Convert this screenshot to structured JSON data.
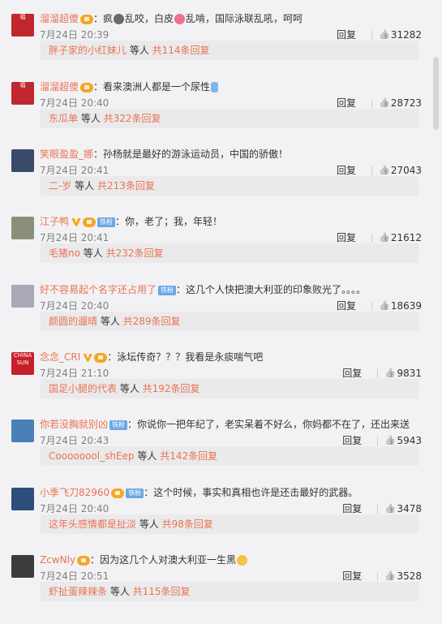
{
  "comments": [
    {
      "user": "溜溜超傻",
      "badges": [
        "crown"
      ],
      "text_parts": [
        "：疯",
        "乱咬，白皮",
        "乱啃，国际泳联乱吼，呵呵"
      ],
      "emojis": [
        "ghost-emoji",
        "pig-emoji"
      ],
      "time": "7月24日 20:39",
      "reply_label": "回复",
      "likes": "31282",
      "sub_user": "胖子家的小红妹儿",
      "sub_mid": " 等人 ",
      "sub_total": "共114条回复",
      "avatar_text": "福",
      "avatar_color": "#c0282d"
    },
    {
      "user": "溜溜超傻",
      "badges": [
        "crown"
      ],
      "text_parts": [
        "：看来澳洲人都是一个尿性",
        "",
        ""
      ],
      "emojis": [
        "drink-emoji"
      ],
      "time": "7月24日 20:40",
      "reply_label": "回复",
      "likes": "28723",
      "sub_user": "东瓜单",
      "sub_mid": " 等人 ",
      "sub_total": "共322条回复",
      "avatar_text": "福",
      "avatar_color": "#c0282d"
    },
    {
      "user": "笑眼盈盈_娜",
      "badges": [],
      "text_parts": [
        "：孙杨就是最好的游泳运动员，中国的骄傲！",
        "",
        ""
      ],
      "emojis": [],
      "time": "7月24日 20:41",
      "reply_label": "回复",
      "likes": "27043",
      "sub_user": "二-岁",
      "sub_mid": " 等人 ",
      "sub_total": "共213条回复",
      "avatar_text": "",
      "avatar_color": "#3a4a6b"
    },
    {
      "user": "江子鸭",
      "badges": [
        "vip",
        "crown",
        "tiefen"
      ],
      "text_parts": [
        "：你，老了；我，年轻！",
        "",
        ""
      ],
      "emojis": [],
      "time": "7月24日 20:41",
      "reply_label": "回复",
      "likes": "21612",
      "sub_user": "毛猪no",
      "sub_mid": " 等人 ",
      "sub_total": "共232条回复",
      "avatar_text": "",
      "avatar_color": "#8a8f7a"
    },
    {
      "user": "好不容易起个名字还占用了",
      "badges": [
        "tiefen"
      ],
      "text_parts": [
        "：这几个人快把澳大利亚的印象败光了。。。。",
        "",
        ""
      ],
      "emojis": [],
      "time": "7月24日 20:40",
      "reply_label": "回复",
      "likes": "18639",
      "sub_user": "颜圆的遛晴",
      "sub_mid": " 等人 ",
      "sub_total": "共289条回复",
      "avatar_text": "",
      "avatar_color": "#a9a9b5"
    },
    {
      "user": "念念_CRI",
      "badges": [
        "vip",
        "crown"
      ],
      "text_parts": [
        "：泳坛传奇？？？我看是永痰喘气吧",
        "",
        ""
      ],
      "emojis": [],
      "time": "7月24日 21:10",
      "reply_label": "回复",
      "likes": "9831",
      "sub_user": "国足小腿的代表",
      "sub_mid": " 等人 ",
      "sub_total": "共192条回复",
      "avatar_text": "CHINA SUN",
      "avatar_color": "#c8202a"
    },
    {
      "user": "你若没胸就别凶",
      "badges": [
        "tiefen"
      ],
      "text_parts": [
        "：你说你一把年纪了，老实呆着不好么，你妈都不在了，还出来送",
        "",
        ""
      ],
      "emojis": [],
      "time": "7月24日 20:43",
      "reply_label": "回复",
      "likes": "5943",
      "sub_user": "Coooooool_shEep",
      "sub_mid": " 等人 ",
      "sub_total": "共142条回复",
      "avatar_text": "",
      "avatar_color": "#4a7fb8"
    },
    {
      "user": "小季飞刀82960",
      "badges": [
        "crown",
        "tiefen"
      ],
      "text_parts": [
        "：这个时候，事实和真相也许是还击最好的武器。",
        "",
        ""
      ],
      "emojis": [],
      "time": "7月24日 20:40",
      "reply_label": "回复",
      "likes": "3478",
      "sub_user": "这年头感情都是扯淡",
      "sub_mid": " 等人 ",
      "sub_total": "共98条回复",
      "avatar_text": "",
      "avatar_color": "#2d4e7a"
    },
    {
      "user": "ZcwNly",
      "badges": [
        "crown"
      ],
      "text_parts": [
        "：因为这几个人对澳大利亚一生黑",
        "",
        ""
      ],
      "emojis": [
        "pray-emoji"
      ],
      "time": "7月24日 20:51",
      "reply_label": "回复",
      "likes": "3528",
      "sub_user": "虾扯蛋辣辣条",
      "sub_mid": " 等人 ",
      "sub_total": "共115条回复",
      "avatar_text": "",
      "avatar_color": "#3b3b3b"
    }
  ]
}
